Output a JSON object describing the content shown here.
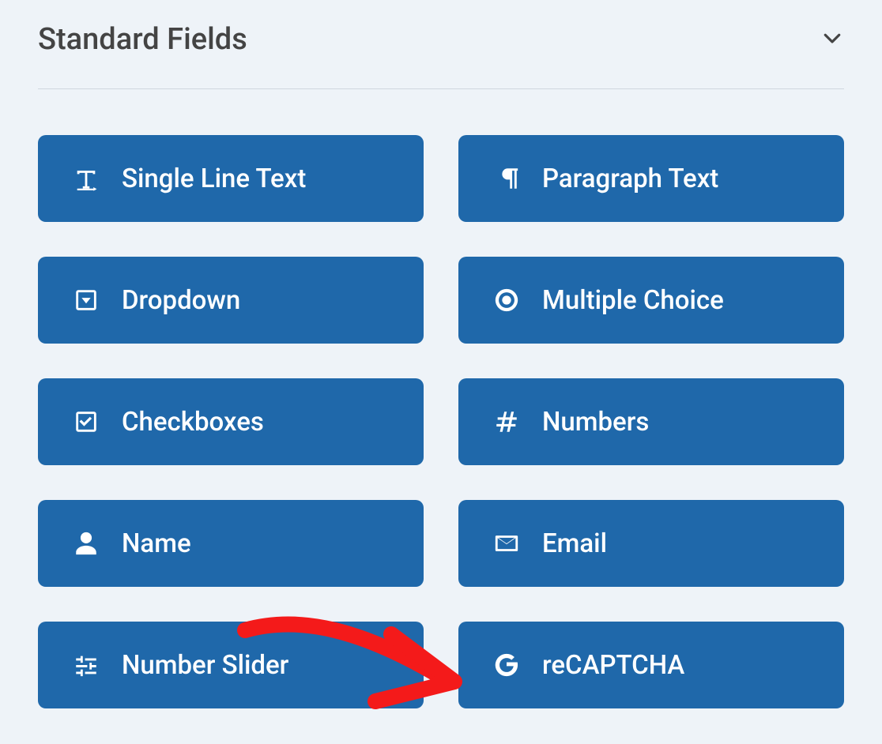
{
  "section": {
    "title": "Standard Fields"
  },
  "fields": [
    {
      "id": "single-line-text",
      "label": "Single Line Text",
      "icon": "text-icon"
    },
    {
      "id": "paragraph-text",
      "label": "Paragraph Text",
      "icon": "paragraph-icon"
    },
    {
      "id": "dropdown",
      "label": "Dropdown",
      "icon": "dropdown-icon"
    },
    {
      "id": "multiple-choice",
      "label": "Multiple Choice",
      "icon": "radio-icon"
    },
    {
      "id": "checkboxes",
      "label": "Checkboxes",
      "icon": "checkbox-icon"
    },
    {
      "id": "numbers",
      "label": "Numbers",
      "icon": "hash-icon"
    },
    {
      "id": "name",
      "label": "Name",
      "icon": "user-icon"
    },
    {
      "id": "email",
      "label": "Email",
      "icon": "envelope-icon"
    },
    {
      "id": "number-slider",
      "label": "Number Slider",
      "icon": "slider-icon"
    },
    {
      "id": "recaptcha",
      "label": "reCAPTCHA",
      "icon": "google-icon"
    }
  ],
  "colors": {
    "background": "#eef3f8",
    "button": "#1f68aa",
    "buttonText": "#ffffff",
    "heading": "#444444",
    "annotation": "#f41a1a"
  }
}
